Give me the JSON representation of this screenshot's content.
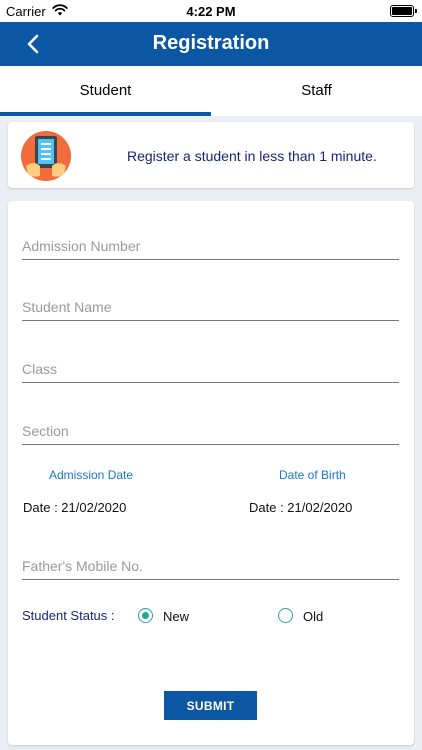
{
  "status_bar": {
    "carrier": "Carrier",
    "time": "4:22 PM"
  },
  "nav": {
    "title": "Registration",
    "back_icon": "chevron-left-icon"
  },
  "tabs": [
    {
      "label": "Student",
      "selected": true
    },
    {
      "label": "Staff",
      "selected": false
    }
  ],
  "banner": {
    "icon": "tablet-form-icon",
    "text": "Register a student in less than 1 minute."
  },
  "form": {
    "admission_number": {
      "placeholder": "Admission Number",
      "value": ""
    },
    "student_name": {
      "placeholder": "Student Name",
      "value": ""
    },
    "class": {
      "placeholder": "Class",
      "value": ""
    },
    "section": {
      "placeholder": "Section",
      "value": ""
    },
    "admission_date": {
      "label": "Admission Date",
      "value": "Date : 21/02/2020"
    },
    "date_of_birth": {
      "label": "Date of Birth",
      "value": "Date : 21/02/2020"
    },
    "fathers_mobile": {
      "placeholder": "Father's Mobile No.",
      "value": ""
    },
    "student_status": {
      "label": "Student Status :",
      "options": [
        {
          "label": "New",
          "selected": true
        },
        {
          "label": "Old",
          "selected": false
        }
      ]
    },
    "submit_label": "SUBMIT"
  },
  "colors": {
    "primary": "#0b57a4",
    "radio": "#26a69a",
    "banner_text": "#1a237e",
    "date_label": "#1976d2"
  }
}
